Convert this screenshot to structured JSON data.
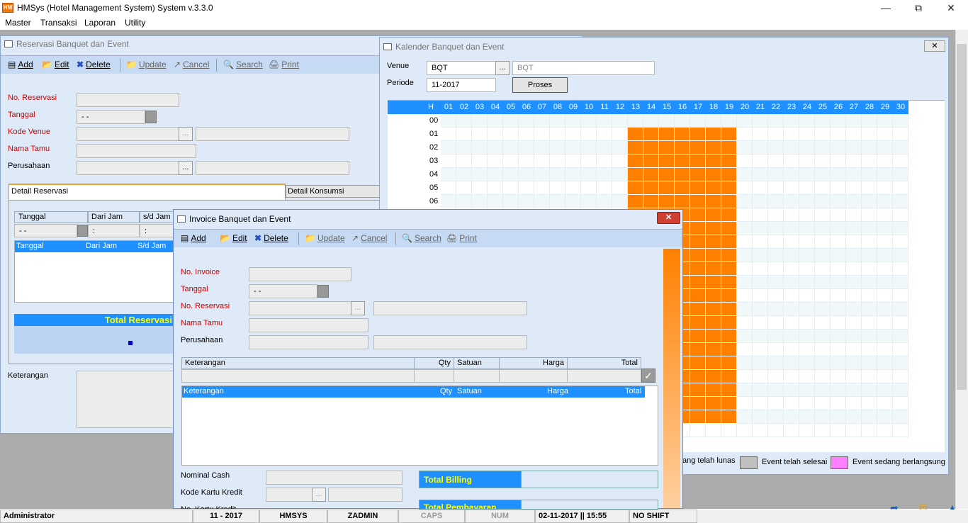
{
  "app": {
    "title": "HMSys (Hotel Management System) System v.3.3.0",
    "icon": "hotel-app-icon"
  },
  "menu": [
    "Master",
    "Transaksi",
    "Laporan",
    "Utility"
  ],
  "toolbar": {
    "add": "Add",
    "edit": "Edit",
    "delete": "Delete",
    "update": "Update",
    "cancel": "Cancel",
    "search": "Search",
    "print": "Print"
  },
  "reservasi": {
    "title": "Reservasi Banquet dan Event",
    "labels": {
      "no": "No. Reservasi",
      "tanggal": "Tanggal",
      "venue": "Kode Venue",
      "nama": "Nama Tamu",
      "perusahaan": "Perusahaan",
      "keterangan": "Keterangan"
    },
    "tanggal_value": " -  -",
    "tabs": [
      "Detail Reservasi",
      "Detail Konsumsi"
    ],
    "grid_headers": [
      "Tanggal",
      "Dari Jam",
      "s/d Jam"
    ],
    "grid_inputs": [
      " -  -",
      " :",
      " :"
    ],
    "list_headers": [
      "Tanggal",
      "Dari Jam",
      "S/d Jam"
    ],
    "total_label": "Total Reservasi"
  },
  "kalender": {
    "title": "Kalender Banquet dan Event",
    "venue_label": "Venue",
    "venue_code": "BQT",
    "venue_name": "BQT",
    "periode_label": "Periode",
    "periode_value": "11-2017",
    "proses": "Proses",
    "hour_header": "H",
    "days": [
      "01",
      "02",
      "03",
      "04",
      "05",
      "06",
      "07",
      "08",
      "09",
      "10",
      "11",
      "12",
      "13",
      "14",
      "15",
      "16",
      "17",
      "18",
      "19",
      "20",
      "21",
      "22",
      "23",
      "24",
      "25",
      "26",
      "27",
      "28",
      "29",
      "30"
    ],
    "hours": [
      "00",
      "01",
      "02",
      "03",
      "04",
      "05",
      "06"
    ],
    "booked_days": [
      "13",
      "14",
      "15",
      "16",
      "17",
      "18",
      "19"
    ],
    "booked_hours_from": "01",
    "legend": [
      "ang telah lunas",
      "Event telah selesai",
      "Event sedang berlangsung"
    ],
    "colors": {
      "booked": "#ff8000",
      "selesai": "#c0c0c0",
      "berlangsung": "#ff80ff",
      "header": "#1e90ff"
    }
  },
  "invoice": {
    "title": "Invoice Banquet dan Event",
    "labels": {
      "no": "No. Invoice",
      "tanggal": "Tanggal",
      "reservasi": "No. Reservasi",
      "nama": "Nama Tamu",
      "perusahaan": "Perusahaan",
      "cash": "Nominal Cash",
      "kartu": "Kode Kartu Kredit",
      "nokartu": "No. Kartu Kredit"
    },
    "tanggal_value": " -  -",
    "grid_headers": [
      "Keterangan",
      "Qty",
      "Satuan",
      "Harga",
      "Total"
    ],
    "list_headers": [
      "Keterangan",
      "Qty",
      "Satuan",
      "Harga",
      "Total"
    ],
    "total_billing": "Total Billing",
    "total_pembayaran": "Total Pembayaran"
  },
  "status": {
    "user": "Administrator",
    "period": "11 - 2017",
    "db": "HMSYS",
    "login": "ZADMIN",
    "caps": "CAPS",
    "num": "NUM",
    "datetime": "02-11-2017 || 15:55",
    "shift": "NO SHIFT"
  }
}
